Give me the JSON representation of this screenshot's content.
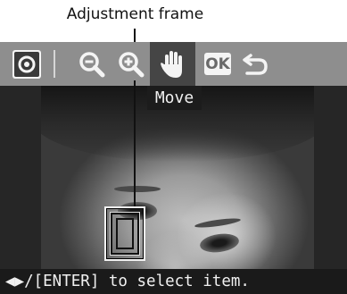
{
  "callout": {
    "label": "Adjustment frame"
  },
  "toolbar": {
    "items": [
      {
        "icon": "preview-icon"
      },
      {
        "icon": "zoom-out-icon"
      },
      {
        "icon": "zoom-in-icon"
      },
      {
        "icon": "hand-move-icon",
        "selected": true
      },
      {
        "icon": "ok-icon",
        "label": "OK"
      },
      {
        "icon": "back-icon"
      }
    ]
  },
  "tooltip": {
    "label": "Move"
  },
  "status": {
    "text": "◀▶/[ENTER] to select item."
  },
  "colors": {
    "toolbar": "#8e8e8e",
    "selected_tool": "#454545",
    "screen": "#262626",
    "status_bar": "#1a1a1a"
  }
}
